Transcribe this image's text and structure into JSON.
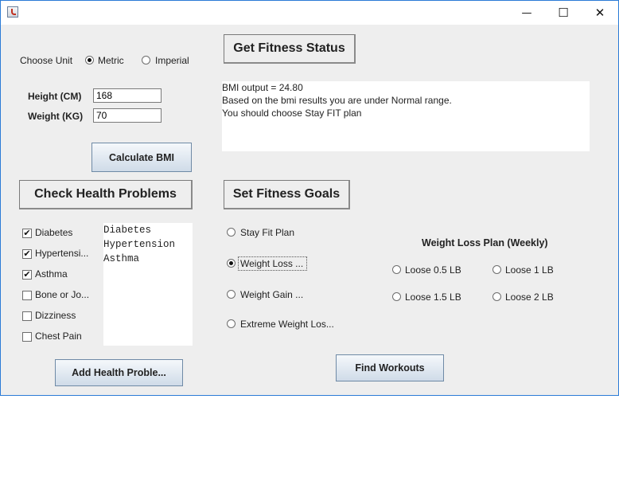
{
  "window": {
    "title": "",
    "controls": {
      "minimize": "—",
      "maximize": "☐",
      "close": "✕"
    }
  },
  "units": {
    "label": "Choose Unit",
    "options": [
      "Metric",
      "Imperial"
    ],
    "selected": "Metric"
  },
  "inputs": {
    "height_label": "Height (CM)",
    "height_value": "168",
    "weight_label": "Weight (KG)",
    "weight_value": "70"
  },
  "buttons": {
    "calculate": "Calculate BMI",
    "get_status": "Get Fitness Status",
    "check_health": "Check Health Problems",
    "set_goals": "Set Fitness Goals",
    "add_health": "Add Health Proble...",
    "find_workouts": "Find Workouts"
  },
  "output": {
    "lines": [
      "BMI output = 24.80",
      "Based on the bmi results you are under Normal range.",
      "You should choose Stay FIT plan"
    ]
  },
  "health": {
    "checkboxes": [
      {
        "label": "Diabetes",
        "checked": true
      },
      {
        "label": "Hypertensi...",
        "checked": true
      },
      {
        "label": "Asthma",
        "checked": true
      },
      {
        "label": "Bone or Jo...",
        "checked": false
      },
      {
        "label": "Dizziness",
        "checked": false
      },
      {
        "label": "Chest Pain",
        "checked": false
      }
    ],
    "list": [
      "Diabetes",
      "Hypertension",
      "Asthma"
    ]
  },
  "goals": {
    "options": [
      "Stay Fit Plan",
      "Weight Loss ...",
      "Weight Gain ...",
      "Extreme Weight Los..."
    ],
    "selected": "Weight Loss ..."
  },
  "weight_loss_plan": {
    "title": "Weight Loss Plan (Weekly)",
    "options": [
      "Loose 0.5 LB",
      "Loose 1 LB",
      "Loose 1.5 LB",
      "Loose 2 LB"
    ]
  }
}
